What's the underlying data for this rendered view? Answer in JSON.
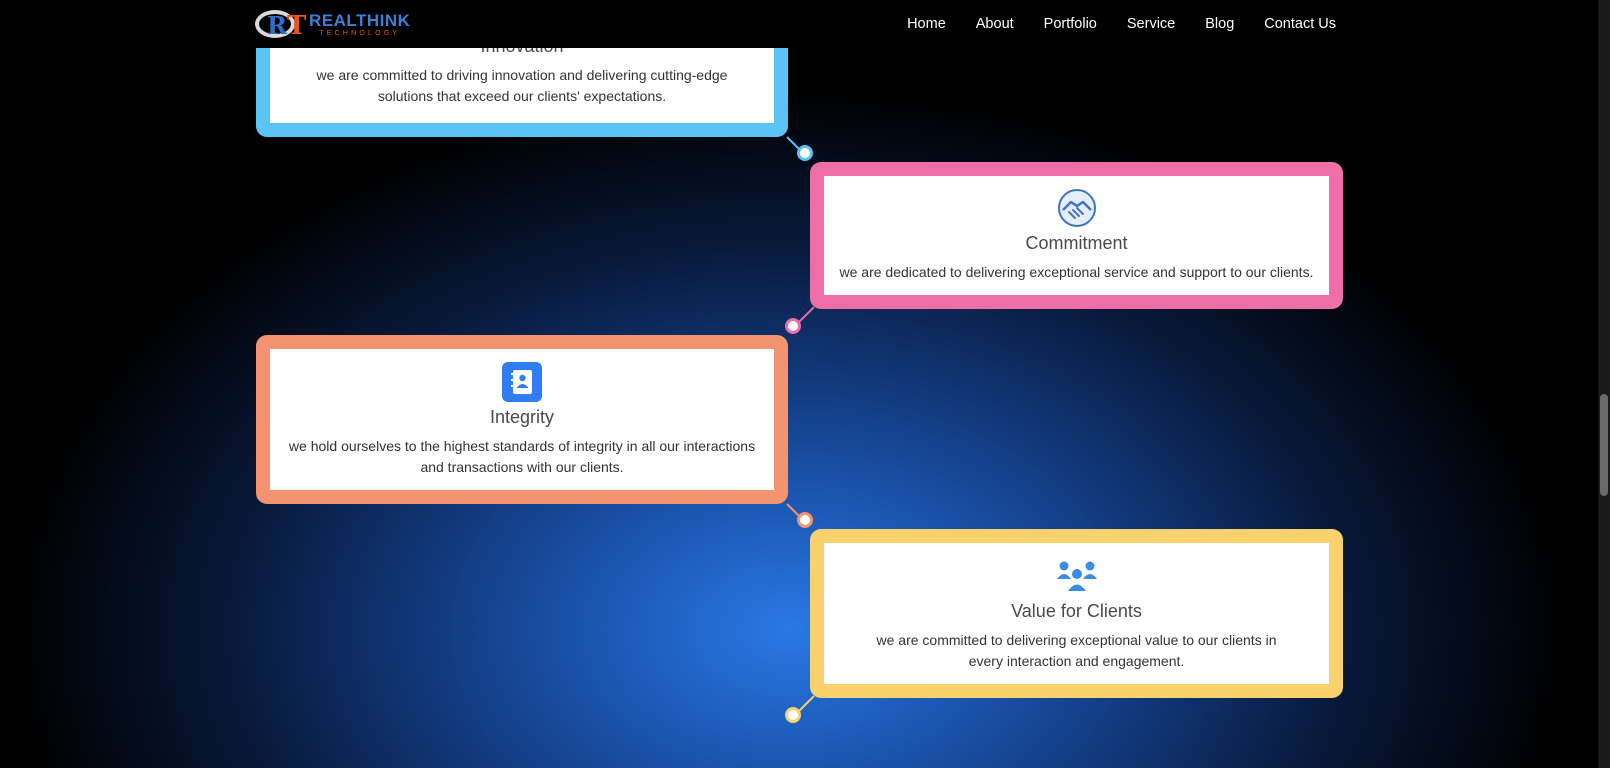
{
  "brand": {
    "name": "REALTHINK",
    "sub": "TECHNOLOGY",
    "mark_r": "R",
    "mark_t": "T"
  },
  "nav": [
    "Home",
    "About",
    "Portfolio",
    "Service",
    "Blog",
    "Contact Us"
  ],
  "timeline": [
    {
      "title": "Innovation",
      "description": "we are committed to driving innovation and delivering cutting-edge solutions that exceed our clients' expectations.",
      "color": "#5bc4f4",
      "icon": "lightbulb-icon"
    },
    {
      "title": "Commitment",
      "description": "we are dedicated to delivering exceptional service and support to our clients.",
      "color": "#ee6fa8",
      "icon": "handshake-icon"
    },
    {
      "title": "Integrity",
      "description": "we hold ourselves to the highest standards of integrity in all our interactions and transactions with our clients.",
      "color": "#f4936f",
      "icon": "contact-book-icon"
    },
    {
      "title": "Value for Clients",
      "description": "we are committed to delivering exceptional value to our clients in every interaction and engagement.",
      "color": "#f9d16d",
      "icon": "users-group-icon"
    }
  ]
}
